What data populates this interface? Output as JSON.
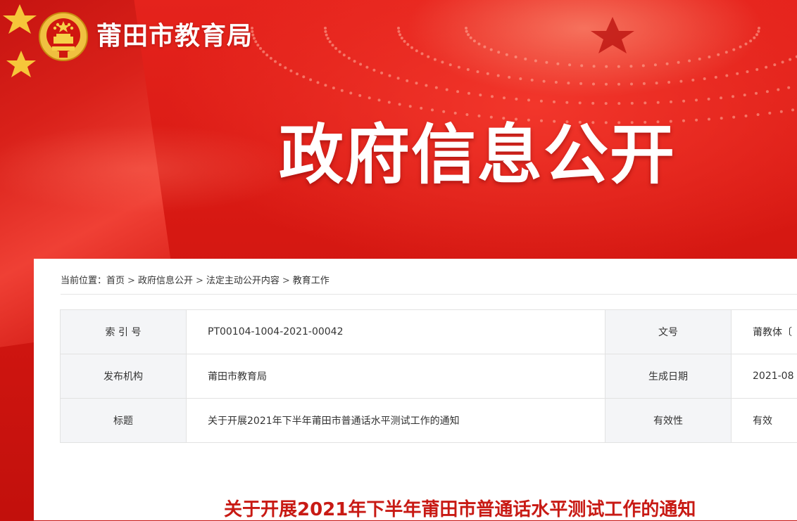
{
  "header": {
    "site_title": "莆田市教育局",
    "big_title": "政府信息公开"
  },
  "breadcrumb": {
    "prefix": "当前位置：",
    "items": [
      "首页",
      "政府信息公开",
      "法定主动公开内容",
      "教育工作"
    ],
    "separator": ">"
  },
  "info_table": {
    "rows": [
      {
        "label1": "索 引 号",
        "value1": "PT00104-1004-2021-00042",
        "label2": "文号",
        "value2": "莆教体〔"
      },
      {
        "label1": "发布机构",
        "value1": "莆田市教育局",
        "label2": "生成日期",
        "value2": "2021-08"
      },
      {
        "label1": "标题",
        "value1": "关于开展2021年下半年莆田市普通话水平测试工作的通知",
        "label2": "有效性",
        "value2": "有效"
      }
    ]
  },
  "document": {
    "title": "关于开展2021年下半年莆田市普通话水平测试工作的通知"
  },
  "colors": {
    "banner_red": "#d61812",
    "title_red": "#c81a14",
    "label_bg": "#f4f5f7"
  },
  "icons": [
    "national-emblem-icon",
    "flag-star-icon"
  ]
}
